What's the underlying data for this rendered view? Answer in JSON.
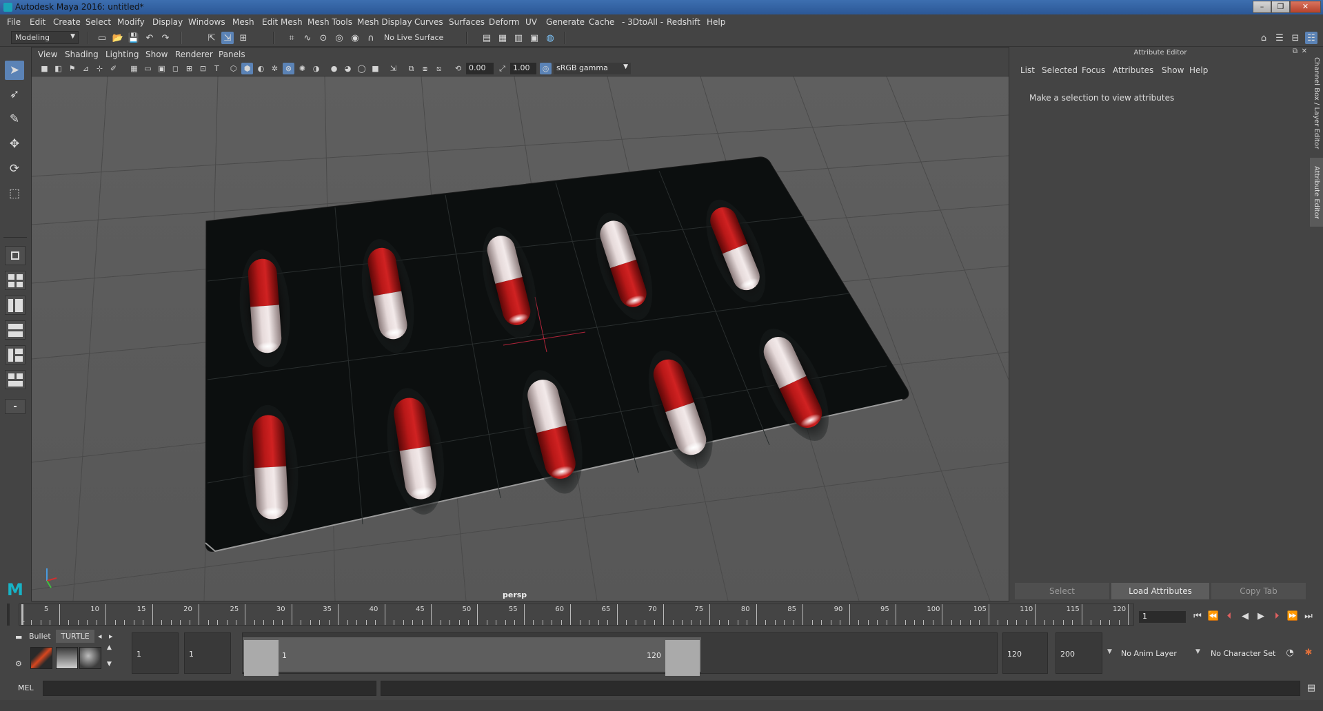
{
  "window": {
    "title": "Autodesk Maya 2016: untitled*",
    "controls": [
      "–",
      "❐",
      "✕"
    ]
  },
  "menubar": [
    "File",
    "Edit",
    "Create",
    "Select",
    "Modify",
    "Display",
    "Windows",
    "Mesh",
    "Edit Mesh",
    "Mesh Tools",
    "Mesh Display",
    "Curves",
    "Surfaces",
    "Deform",
    "UV",
    "Generate",
    "Cache",
    "- 3DtoAll -",
    "Redshift",
    "Help"
  ],
  "statusline": {
    "mode_menu": "Modeling",
    "live_surface": "No Live Surface"
  },
  "viewport": {
    "menu": [
      "View",
      "Shading",
      "Lighting",
      "Show",
      "Renderer",
      "Panels"
    ],
    "exposure": "0.00",
    "gamma": "1.00",
    "color_space": "sRGB gamma",
    "camera": "persp"
  },
  "attribute_editor": {
    "title": "Attribute Editor",
    "menu": [
      "List",
      "Selected",
      "Focus",
      "Attributes",
      "Show",
      "Help"
    ],
    "message": "Make a selection to view attributes",
    "buttons": {
      "select": "Select",
      "load": "Load Attributes",
      "copy": "Copy Tab"
    }
  },
  "side_tabs": {
    "channel_box": "Channel Box / Layer Editor",
    "attribute_editor": "Attribute Editor"
  },
  "timeline": {
    "ticks": [
      "5",
      "10",
      "15",
      "20",
      "25",
      "30",
      "35",
      "40",
      "45",
      "50",
      "55",
      "60",
      "65",
      "70",
      "75",
      "80",
      "85",
      "90",
      "95",
      "100",
      "105",
      "110",
      "115",
      "120"
    ],
    "start_label": "1",
    "current_frame": "1"
  },
  "range": {
    "start_time": "1",
    "playback_start": "1",
    "range_min": "1",
    "range_max": "120",
    "playback_end": "120",
    "end_time": "200",
    "anim_layer": "No Anim Layer",
    "character_set": "No Character Set"
  },
  "shelf": {
    "tab_bullet": "Bullet",
    "tab_turtle": "TURTLE"
  },
  "command_line": {
    "language": "MEL"
  }
}
